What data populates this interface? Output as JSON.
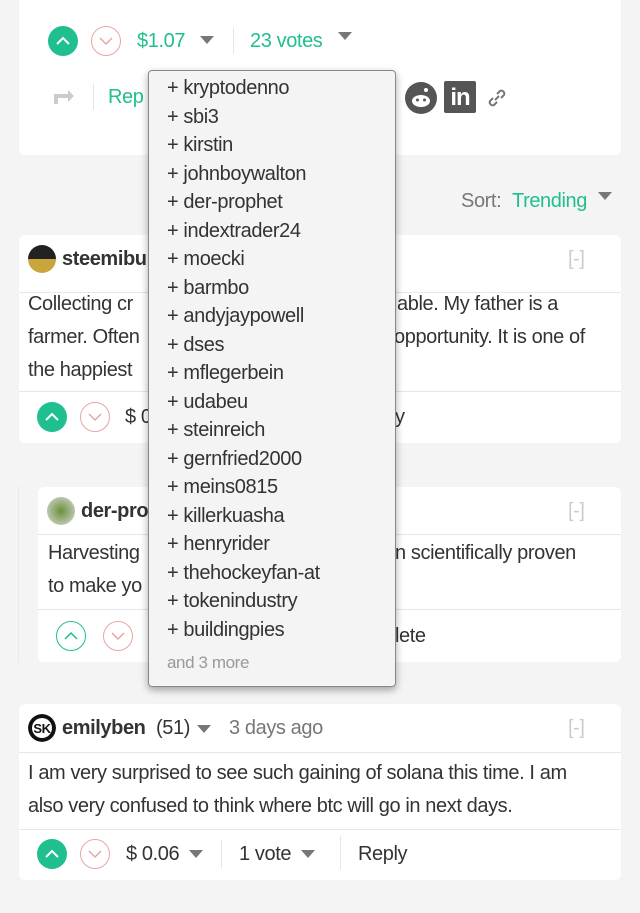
{
  "post": {
    "payout": "$1.07",
    "votes": "23 votes",
    "reply": "Rep"
  },
  "sort": {
    "label": "Sort:",
    "value": "Trending"
  },
  "comments": [
    {
      "author": "steemibu",
      "collapse": "[-]",
      "body_left": [
        "Collecting cr",
        "farmer. Often",
        "the happiest"
      ],
      "body_right": [
        "able. My father is a",
        "opportunity. It is one of",
        ""
      ],
      "payout": "$ 0",
      "action_fragment": "ly"
    },
    {
      "author": "der-pro",
      "collapse": "[-]",
      "body_left": [
        "Harvesting",
        "to make yo"
      ],
      "body_right": [
        "n scientifically proven",
        ""
      ],
      "action_fragment": "lete"
    },
    {
      "author": "emilyben",
      "reputation": "(51)",
      "time": "3 days ago",
      "collapse": "[-]",
      "body": [
        "I am very surprised to see such gaining of solana this time. I am",
        "also very confused to think where btc will go in next days."
      ],
      "payout": "$ 0.06",
      "votes": "1 vote",
      "reply": "Reply"
    }
  ],
  "voters_dropdown": {
    "items": [
      "+ kryptodenno",
      "+ sbi3",
      "+ kirstin",
      "+ johnboywalton",
      "+ der-prophet",
      "+ indextrader24",
      "+ moecki",
      "+ barmbo",
      "+ andyjaypowell",
      "+ dses",
      "+ mflegerbein",
      "+ udabeu",
      "+ steinreich",
      "+ gernfried2000",
      "+ meins0815",
      "+ killerkuasha",
      "+ henryrider",
      "+ thehockeyfan-at",
      "+ tokenindustry",
      "+ buildingpies"
    ],
    "more": "and 3 more"
  },
  "colors": {
    "accent": "#1fbf8f",
    "downvote": "#e8a5a5",
    "background": "#f4f4f4"
  }
}
